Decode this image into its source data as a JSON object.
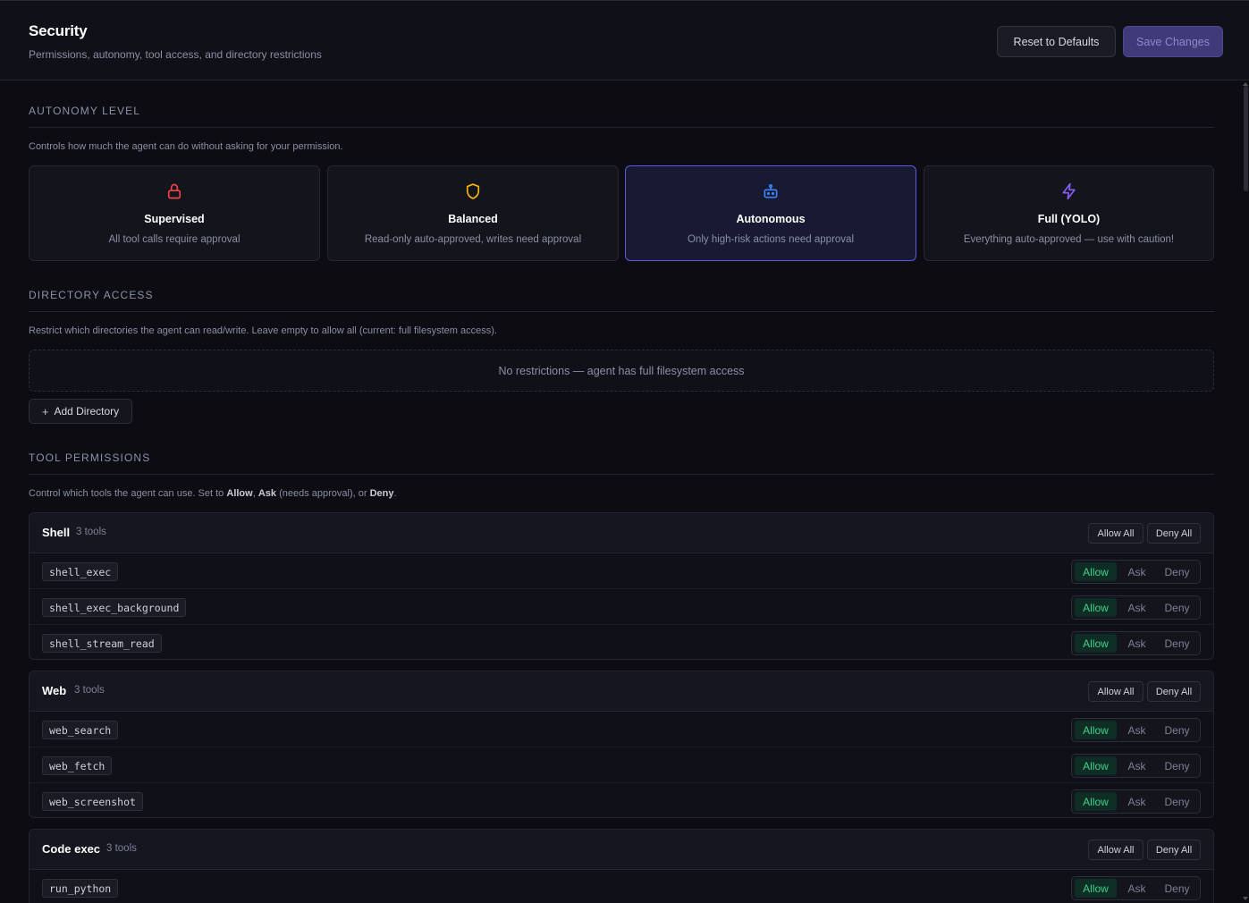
{
  "header": {
    "title": "Security",
    "subtitle": "Permissions, autonomy, tool access, and directory restrictions",
    "reset_label": "Reset to Defaults",
    "save_label": "Save Changes"
  },
  "autonomy": {
    "heading": "Autonomy Level",
    "description": "Controls how much the agent can do without asking for your permission.",
    "selected": "Autonomous",
    "options": [
      {
        "name": "Supervised",
        "desc": "All tool calls require approval",
        "icon": "lock-icon",
        "color": "#ef4444"
      },
      {
        "name": "Balanced",
        "desc": "Read-only auto-approved, writes need approval",
        "icon": "shield-icon",
        "color": "#f5b50a"
      },
      {
        "name": "Autonomous",
        "desc": "Only high-risk actions need approval",
        "icon": "robot-icon",
        "color": "#3b82f6"
      },
      {
        "name": "Full (YOLO)",
        "desc": "Everything auto-approved — use with caution!",
        "icon": "lightning-icon",
        "color": "#8b5cf6"
      }
    ]
  },
  "directory": {
    "heading": "Directory Access",
    "description": "Restrict which directories the agent can read/write. Leave empty to allow all (current: full filesystem access).",
    "empty_text": "No restrictions — agent has full filesystem access",
    "add_label": "Add Directory"
  },
  "tools": {
    "heading": "Tool Permissions",
    "desc_prefix": "Control which tools the agent can use. Set to",
    "allow_word": "Allow",
    "ask_word": "Ask",
    "desc_middle": "(needs approval), or",
    "deny_word": "Deny",
    "allow_all_label": "Allow All",
    "deny_all_label": "Deny All",
    "option_labels": {
      "allow": "Allow",
      "ask": "Ask",
      "deny": "Deny"
    },
    "groups": [
      {
        "name": "Shell",
        "count": "3 tools",
        "tools": [
          {
            "name": "shell_exec",
            "value": "Allow"
          },
          {
            "name": "shell_exec_background",
            "value": "Allow"
          },
          {
            "name": "shell_stream_read",
            "value": "Allow"
          }
        ]
      },
      {
        "name": "Web",
        "count": "3 tools",
        "tools": [
          {
            "name": "web_search",
            "value": "Allow"
          },
          {
            "name": "web_fetch",
            "value": "Allow"
          },
          {
            "name": "web_screenshot",
            "value": "Allow"
          }
        ]
      },
      {
        "name": "Code exec",
        "count": "3 tools",
        "tools": [
          {
            "name": "run_python",
            "value": "Allow"
          }
        ]
      }
    ]
  },
  "colors": {
    "accent": "#5a5ce0",
    "allow_active": "#3fd08c",
    "background": "#0c0c12"
  }
}
